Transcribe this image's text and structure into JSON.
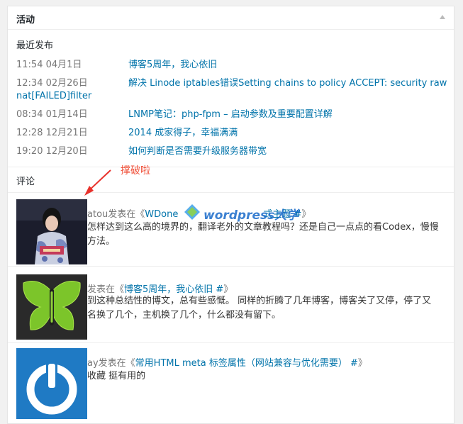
{
  "widget": {
    "title": "活动"
  },
  "recent": {
    "heading": "最近发布",
    "posts": [
      {
        "date": "11:54 04月1日",
        "title": "博客5周年，我心依旧"
      },
      {
        "date": "12:34 02月26日",
        "title": "解决 Linode iptables错误Setting chains to policy ACCEPT: security raw",
        "title_cont": "nat[FAILED]filter"
      },
      {
        "date": "08:34 01月14日",
        "title": "LNMP笔记：php-fpm – 启动参数及重要配置详解"
      },
      {
        "date": "12:28 12月21日",
        "title": "2014 成家得子，幸福满满"
      },
      {
        "date": "19:20 12月20日",
        "title": "如何判断是否需要升级服务器带宽"
      }
    ]
  },
  "comments": {
    "heading": "评论",
    "items": [
      {
        "author_tail": "atou发表在《",
        "post_link": "WDone",
        "post_link_tail": "式主题 #",
        "meta_close": "》",
        "text_line1": "怎样达到这么高的境界的，翻译老外的文章教程吗？还是自己一点点的看Codex，慢慢",
        "text_line2": "方法。"
      },
      {
        "author_tail": "发表在《",
        "post_link": "博客5周年，我心依旧 #",
        "meta_close": "》",
        "text_line1": "到这种总结性的博文，总有些感慨。 同样的折腾了几年博客，博客关了又停，停了又",
        "text_line2": "名换了几个，主机换了几个，什么都没有留下。"
      },
      {
        "author_tail": "ay发表在《",
        "post_link": "常用HTML meta 标签属性（网站兼容与优化需要） #",
        "meta_close": "》",
        "text_line1": "收藏 挺有用的"
      }
    ]
  },
  "annotation": "撑破啦",
  "watermark": "wordpress大学",
  "colors": {
    "link": "#0073aa",
    "annotation": "#f0523b"
  }
}
